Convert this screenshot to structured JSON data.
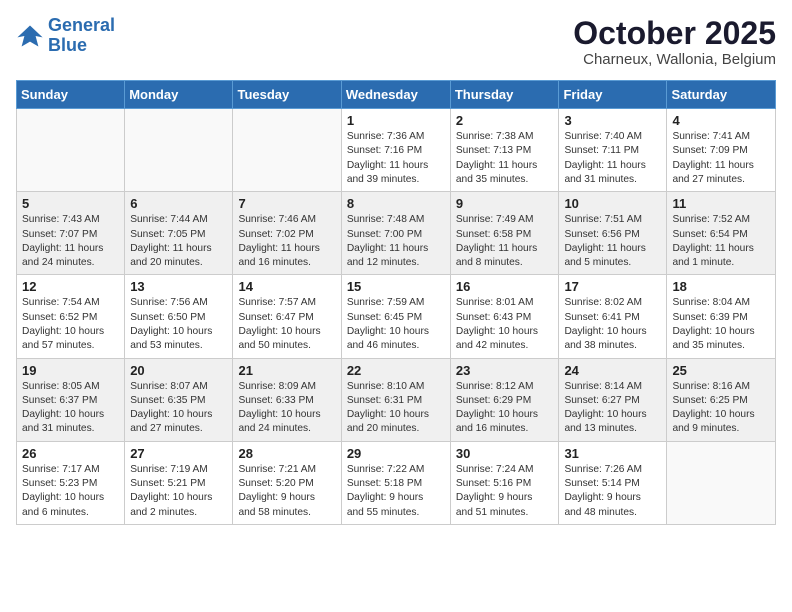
{
  "logo": {
    "line1": "General",
    "line2": "Blue"
  },
  "title": "October 2025",
  "location": "Charneux, Wallonia, Belgium",
  "weekdays": [
    "Sunday",
    "Monday",
    "Tuesday",
    "Wednesday",
    "Thursday",
    "Friday",
    "Saturday"
  ],
  "weeks": [
    [
      {
        "day": "",
        "info": ""
      },
      {
        "day": "",
        "info": ""
      },
      {
        "day": "",
        "info": ""
      },
      {
        "day": "1",
        "info": "Sunrise: 7:36 AM\nSunset: 7:16 PM\nDaylight: 11 hours\nand 39 minutes."
      },
      {
        "day": "2",
        "info": "Sunrise: 7:38 AM\nSunset: 7:13 PM\nDaylight: 11 hours\nand 35 minutes."
      },
      {
        "day": "3",
        "info": "Sunrise: 7:40 AM\nSunset: 7:11 PM\nDaylight: 11 hours\nand 31 minutes."
      },
      {
        "day": "4",
        "info": "Sunrise: 7:41 AM\nSunset: 7:09 PM\nDaylight: 11 hours\nand 27 minutes."
      }
    ],
    [
      {
        "day": "5",
        "info": "Sunrise: 7:43 AM\nSunset: 7:07 PM\nDaylight: 11 hours\nand 24 minutes."
      },
      {
        "day": "6",
        "info": "Sunrise: 7:44 AM\nSunset: 7:05 PM\nDaylight: 11 hours\nand 20 minutes."
      },
      {
        "day": "7",
        "info": "Sunrise: 7:46 AM\nSunset: 7:02 PM\nDaylight: 11 hours\nand 16 minutes."
      },
      {
        "day": "8",
        "info": "Sunrise: 7:48 AM\nSunset: 7:00 PM\nDaylight: 11 hours\nand 12 minutes."
      },
      {
        "day": "9",
        "info": "Sunrise: 7:49 AM\nSunset: 6:58 PM\nDaylight: 11 hours\nand 8 minutes."
      },
      {
        "day": "10",
        "info": "Sunrise: 7:51 AM\nSunset: 6:56 PM\nDaylight: 11 hours\nand 5 minutes."
      },
      {
        "day": "11",
        "info": "Sunrise: 7:52 AM\nSunset: 6:54 PM\nDaylight: 11 hours\nand 1 minute."
      }
    ],
    [
      {
        "day": "12",
        "info": "Sunrise: 7:54 AM\nSunset: 6:52 PM\nDaylight: 10 hours\nand 57 minutes."
      },
      {
        "day": "13",
        "info": "Sunrise: 7:56 AM\nSunset: 6:50 PM\nDaylight: 10 hours\nand 53 minutes."
      },
      {
        "day": "14",
        "info": "Sunrise: 7:57 AM\nSunset: 6:47 PM\nDaylight: 10 hours\nand 50 minutes."
      },
      {
        "day": "15",
        "info": "Sunrise: 7:59 AM\nSunset: 6:45 PM\nDaylight: 10 hours\nand 46 minutes."
      },
      {
        "day": "16",
        "info": "Sunrise: 8:01 AM\nSunset: 6:43 PM\nDaylight: 10 hours\nand 42 minutes."
      },
      {
        "day": "17",
        "info": "Sunrise: 8:02 AM\nSunset: 6:41 PM\nDaylight: 10 hours\nand 38 minutes."
      },
      {
        "day": "18",
        "info": "Sunrise: 8:04 AM\nSunset: 6:39 PM\nDaylight: 10 hours\nand 35 minutes."
      }
    ],
    [
      {
        "day": "19",
        "info": "Sunrise: 8:05 AM\nSunset: 6:37 PM\nDaylight: 10 hours\nand 31 minutes."
      },
      {
        "day": "20",
        "info": "Sunrise: 8:07 AM\nSunset: 6:35 PM\nDaylight: 10 hours\nand 27 minutes."
      },
      {
        "day": "21",
        "info": "Sunrise: 8:09 AM\nSunset: 6:33 PM\nDaylight: 10 hours\nand 24 minutes."
      },
      {
        "day": "22",
        "info": "Sunrise: 8:10 AM\nSunset: 6:31 PM\nDaylight: 10 hours\nand 20 minutes."
      },
      {
        "day": "23",
        "info": "Sunrise: 8:12 AM\nSunset: 6:29 PM\nDaylight: 10 hours\nand 16 minutes."
      },
      {
        "day": "24",
        "info": "Sunrise: 8:14 AM\nSunset: 6:27 PM\nDaylight: 10 hours\nand 13 minutes."
      },
      {
        "day": "25",
        "info": "Sunrise: 8:16 AM\nSunset: 6:25 PM\nDaylight: 10 hours\nand 9 minutes."
      }
    ],
    [
      {
        "day": "26",
        "info": "Sunrise: 7:17 AM\nSunset: 5:23 PM\nDaylight: 10 hours\nand 6 minutes."
      },
      {
        "day": "27",
        "info": "Sunrise: 7:19 AM\nSunset: 5:21 PM\nDaylight: 10 hours\nand 2 minutes."
      },
      {
        "day": "28",
        "info": "Sunrise: 7:21 AM\nSunset: 5:20 PM\nDaylight: 9 hours\nand 58 minutes."
      },
      {
        "day": "29",
        "info": "Sunrise: 7:22 AM\nSunset: 5:18 PM\nDaylight: 9 hours\nand 55 minutes."
      },
      {
        "day": "30",
        "info": "Sunrise: 7:24 AM\nSunset: 5:16 PM\nDaylight: 9 hours\nand 51 minutes."
      },
      {
        "day": "31",
        "info": "Sunrise: 7:26 AM\nSunset: 5:14 PM\nDaylight: 9 hours\nand 48 minutes."
      },
      {
        "day": "",
        "info": ""
      }
    ]
  ]
}
